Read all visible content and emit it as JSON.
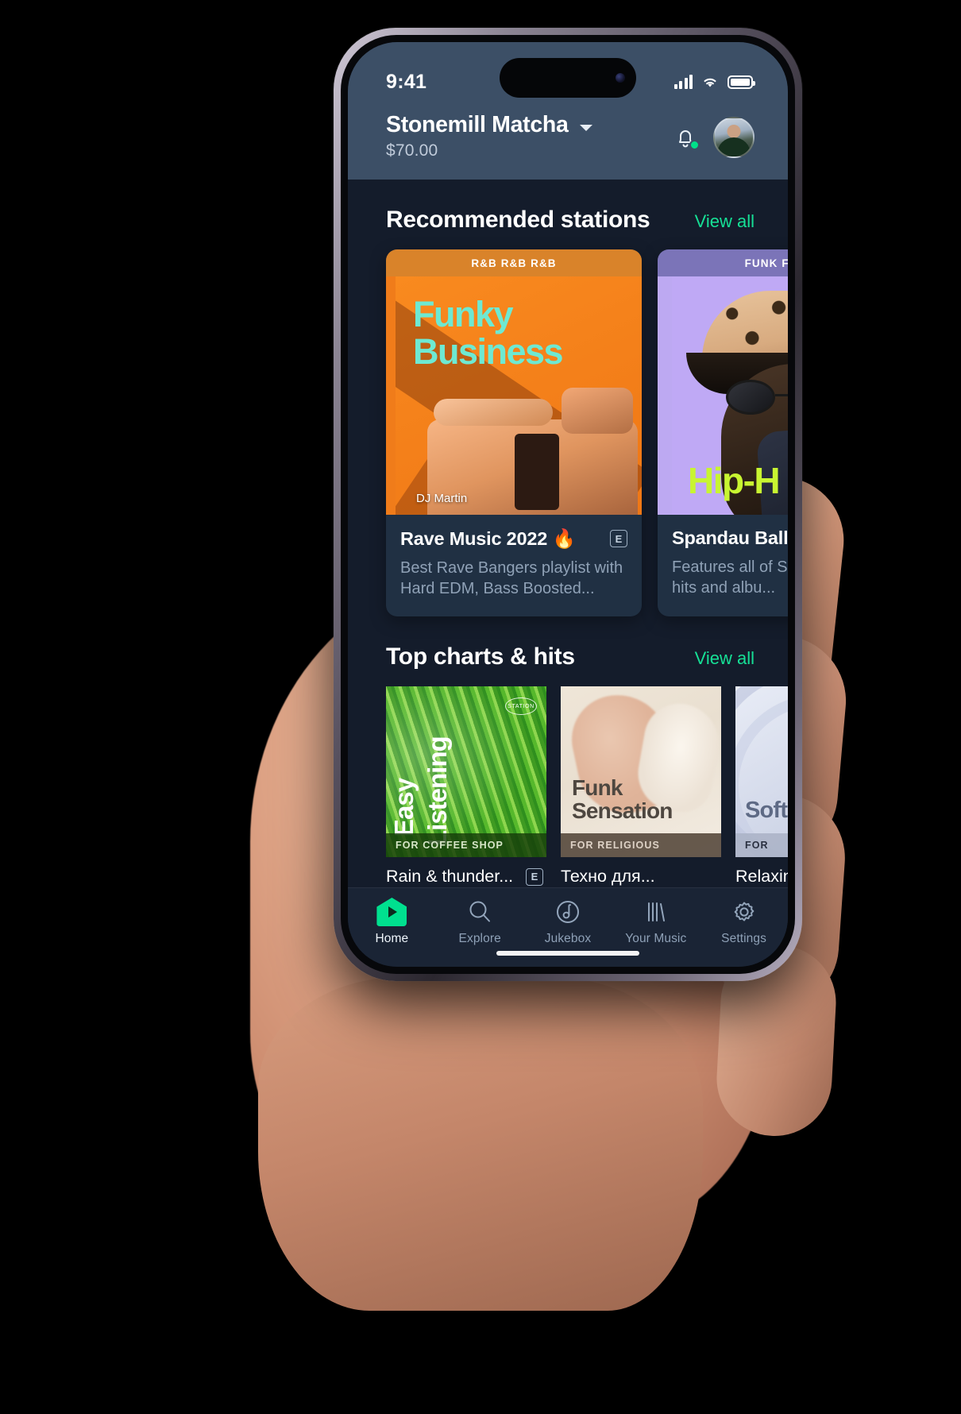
{
  "status_bar": {
    "time": "9:41",
    "signal_icon": "cellular-signal-icon",
    "wifi_icon": "wifi-icon",
    "battery_icon": "battery-full-icon"
  },
  "header": {
    "account_name": "Stonemill Matcha",
    "dropdown_icon": "chevron-down-icon",
    "balance": "$70.00",
    "notification_icon": "bell-icon",
    "avatar_label": "user-avatar"
  },
  "sections": [
    {
      "title": "Recommended stations",
      "view_all_label": "View all",
      "cards": [
        {
          "genre_tags": "R&B  R&B  R&B",
          "art_line1": "Funky",
          "art_line2": "Business",
          "art_credit": "DJ Martin",
          "title": "Rave Music 2022 🔥",
          "explicit_badge": "E",
          "description": "Best Rave Bangers playlist with Hard EDM, Bass Boosted..."
        },
        {
          "genre_tags": "FUNK  FUNK  F",
          "art_line1": "Hip-H",
          "title": "Spandau Ballet: T",
          "description": "Features all of Spand biggest hits and albu..."
        }
      ]
    },
    {
      "title": "Top charts & hits",
      "view_all_label": "View all",
      "cards": [
        {
          "art_line1": "Easy",
          "art_line2": "Listening",
          "seal_text": "STATION",
          "for_label": "FOR COFFEE SHOP",
          "title": "Rain & thunder...",
          "explicit_badge": "E"
        },
        {
          "art_line1": "Funk",
          "art_line2": "Sensation",
          "for_label": "FOR RELIGIOUS",
          "title": "Техно для..."
        },
        {
          "art_line1": "Soft",
          "for_label": "FOR",
          "title": "Relaxing"
        }
      ]
    }
  ],
  "tabbar": {
    "items": [
      {
        "label": "Home",
        "icon": "home-play-icon",
        "active": true
      },
      {
        "label": "Explore",
        "icon": "search-icon",
        "active": false
      },
      {
        "label": "Jukebox",
        "icon": "music-disc-icon",
        "active": false
      },
      {
        "label": "Your Music",
        "icon": "library-icon",
        "active": false
      },
      {
        "label": "Settings",
        "icon": "gear-icon",
        "active": false
      }
    ]
  },
  "colors": {
    "accent_green": "#16e096",
    "header_bg": "#3c4f66",
    "screen_bg": "#141c2b",
    "card_bg": "#203043",
    "tabbar_bg": "#1a2435"
  }
}
